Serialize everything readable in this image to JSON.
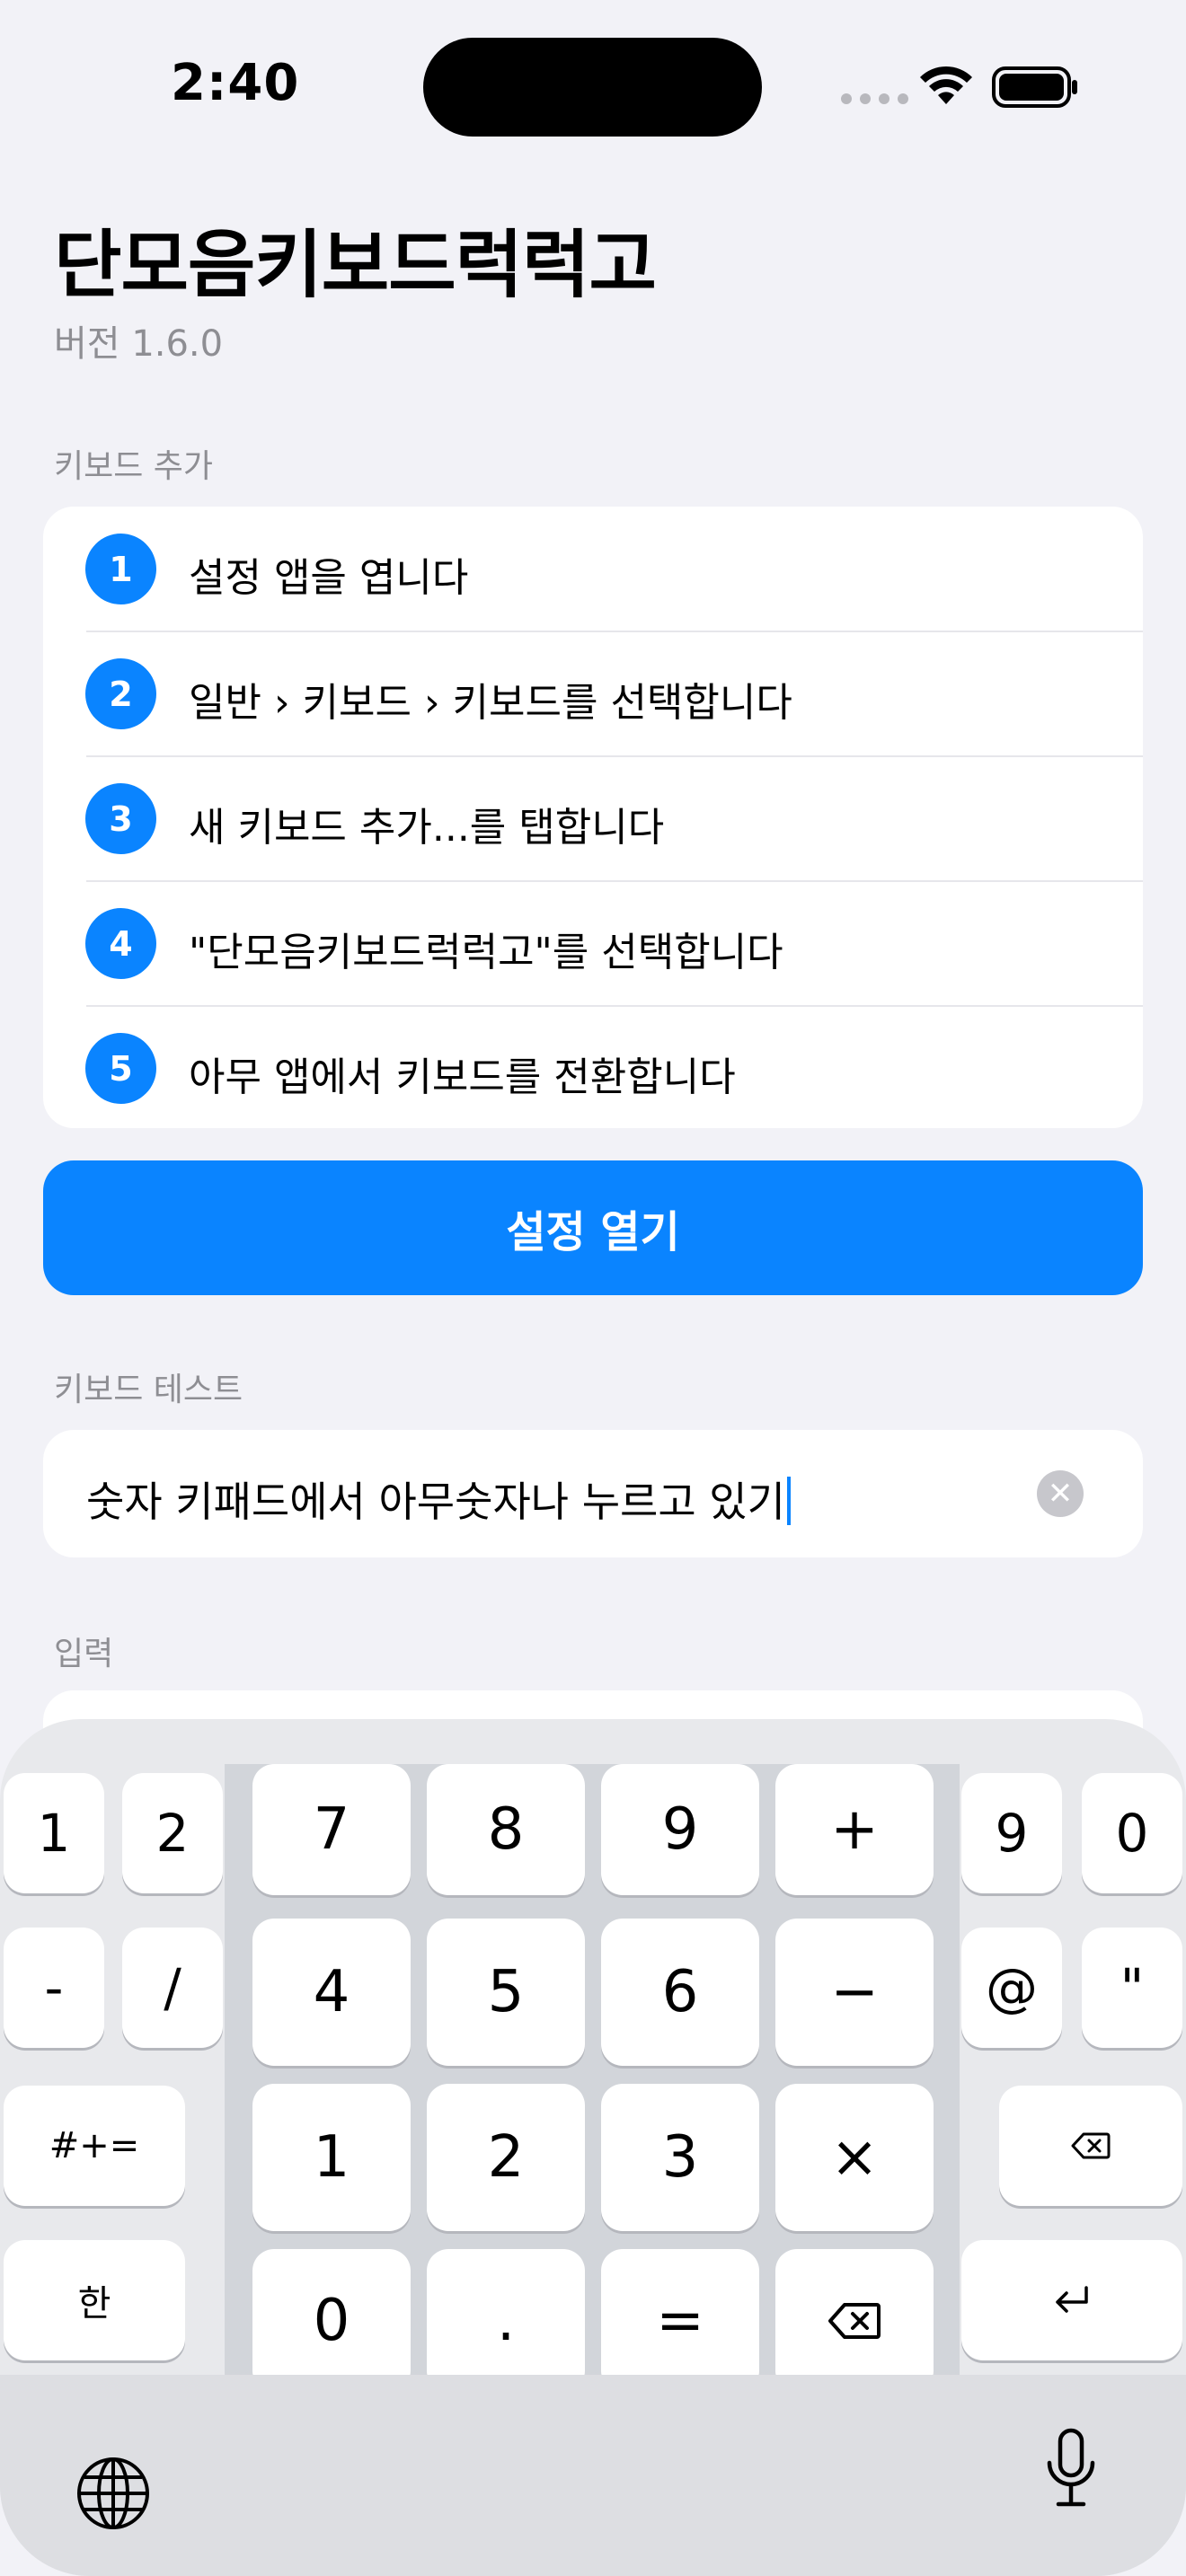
{
  "status_bar": {
    "time": "2:40"
  },
  "header": {
    "title": "단모음키보드럭럭고",
    "version": "버전 1.6.0"
  },
  "add_keyboard": {
    "section_label": "키보드 추가",
    "steps": [
      {
        "number": "1",
        "text": "설정 앱을 엽니다"
      },
      {
        "number": "2",
        "text": "일반 › 키보드 › 키보드를 선택합니다"
      },
      {
        "number": "3",
        "text": "새 키보드 추가...를 탭합니다"
      },
      {
        "number": "4",
        "text": "\"단모음키보드럭럭고\"를 선택합니다"
      },
      {
        "number": "5",
        "text": "아무 앱에서 키보드를 전환합니다"
      }
    ],
    "open_settings_label": "설정 열기"
  },
  "keyboard_test": {
    "section_label": "키보드 테스트",
    "field_value": "숫자 키패드에서 아무숫자나 누르고 있기"
  },
  "input_section": {
    "section_label": "입력"
  },
  "keyboard": {
    "left_keys": [
      "1",
      "2",
      "-",
      "/",
      "#+=",
      "한"
    ],
    "right_keys": [
      "9",
      "0",
      "@",
      "\""
    ],
    "numpad": [
      [
        "7",
        "8",
        "9",
        "+"
      ],
      [
        "4",
        "5",
        "6",
        "−"
      ],
      [
        "1",
        "2",
        "3",
        "×"
      ],
      [
        "0",
        ".",
        "=",
        "delete-icon"
      ]
    ],
    "bottom_bar": [
      "globe-icon",
      "microphone-icon"
    ]
  },
  "colors": {
    "accent": "#0A84FF",
    "background": "#F2F2F7",
    "secondary_text": "#8E8E93"
  }
}
